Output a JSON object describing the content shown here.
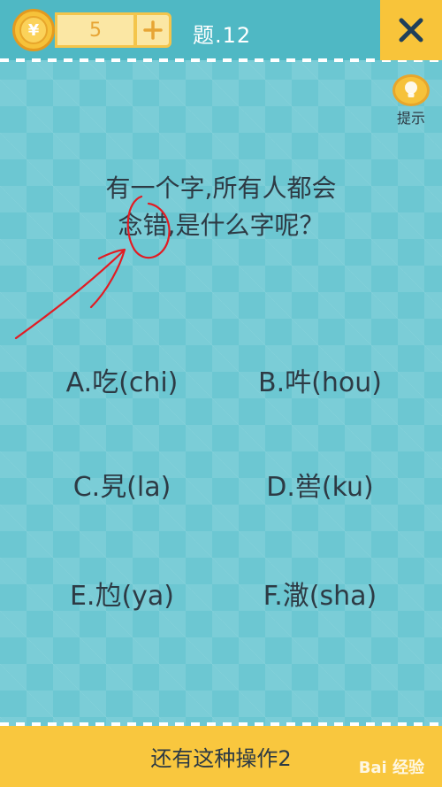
{
  "topbar": {
    "coin_symbol": "¥",
    "coin_count": "5",
    "level_title": "题.12",
    "close_icon": "x-icon"
  },
  "hint": {
    "label": "提示",
    "icon": "lightbulb-icon"
  },
  "question": {
    "line1": "有一个字,所有人都会",
    "line2": "念错,是什么字呢？"
  },
  "options": [
    {
      "label": "A.吃(chi)"
    },
    {
      "label": "B.吽(hou)"
    },
    {
      "label": "C.旯(la)"
    },
    {
      "label": "D.喾(ku)"
    },
    {
      "label": "E.尥(ya)"
    },
    {
      "label": "F.潵(sha)"
    }
  ],
  "bottom": {
    "label": "还有这种操作2"
  },
  "watermark": {
    "text": "Bai 经验"
  },
  "colors": {
    "background": "#6cc7d2",
    "topbar": "#4fb8c4",
    "accent_yellow": "#f8c43a",
    "text_dark": "#2d3a44",
    "annotation_red": "#e21b23"
  }
}
